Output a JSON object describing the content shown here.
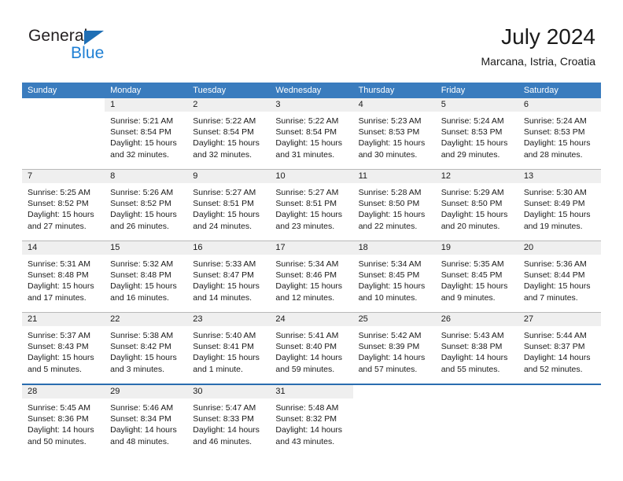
{
  "brand": {
    "word1": "General",
    "word2": "Blue",
    "accent_color": "#1e7fd4"
  },
  "header": {
    "title": "July 2024",
    "subtitle": "Marcana, Istria, Croatia"
  },
  "calendar": {
    "header_color": "#3a7cbe",
    "daynum_band_color": "#efefef",
    "weekday_headers": [
      "Sunday",
      "Monday",
      "Tuesday",
      "Wednesday",
      "Thursday",
      "Friday",
      "Saturday"
    ],
    "weeks": [
      {
        "days": [
          {
            "date": "",
            "empty": true,
            "lines": []
          },
          {
            "date": "1",
            "empty": false,
            "lines": [
              "Sunrise: 5:21 AM",
              "Sunset: 8:54 PM",
              "Daylight: 15 hours",
              "and 32 minutes."
            ]
          },
          {
            "date": "2",
            "empty": false,
            "lines": [
              "Sunrise: 5:22 AM",
              "Sunset: 8:54 PM",
              "Daylight: 15 hours",
              "and 32 minutes."
            ]
          },
          {
            "date": "3",
            "empty": false,
            "lines": [
              "Sunrise: 5:22 AM",
              "Sunset: 8:54 PM",
              "Daylight: 15 hours",
              "and 31 minutes."
            ]
          },
          {
            "date": "4",
            "empty": false,
            "lines": [
              "Sunrise: 5:23 AM",
              "Sunset: 8:53 PM",
              "Daylight: 15 hours",
              "and 30 minutes."
            ]
          },
          {
            "date": "5",
            "empty": false,
            "lines": [
              "Sunrise: 5:24 AM",
              "Sunset: 8:53 PM",
              "Daylight: 15 hours",
              "and 29 minutes."
            ]
          },
          {
            "date": "6",
            "empty": false,
            "lines": [
              "Sunrise: 5:24 AM",
              "Sunset: 8:53 PM",
              "Daylight: 15 hours",
              "and 28 minutes."
            ]
          }
        ]
      },
      {
        "days": [
          {
            "date": "7",
            "empty": false,
            "lines": [
              "Sunrise: 5:25 AM",
              "Sunset: 8:52 PM",
              "Daylight: 15 hours",
              "and 27 minutes."
            ]
          },
          {
            "date": "8",
            "empty": false,
            "lines": [
              "Sunrise: 5:26 AM",
              "Sunset: 8:52 PM",
              "Daylight: 15 hours",
              "and 26 minutes."
            ]
          },
          {
            "date": "9",
            "empty": false,
            "lines": [
              "Sunrise: 5:27 AM",
              "Sunset: 8:51 PM",
              "Daylight: 15 hours",
              "and 24 minutes."
            ]
          },
          {
            "date": "10",
            "empty": false,
            "lines": [
              "Sunrise: 5:27 AM",
              "Sunset: 8:51 PM",
              "Daylight: 15 hours",
              "and 23 minutes."
            ]
          },
          {
            "date": "11",
            "empty": false,
            "lines": [
              "Sunrise: 5:28 AM",
              "Sunset: 8:50 PM",
              "Daylight: 15 hours",
              "and 22 minutes."
            ]
          },
          {
            "date": "12",
            "empty": false,
            "lines": [
              "Sunrise: 5:29 AM",
              "Sunset: 8:50 PM",
              "Daylight: 15 hours",
              "and 20 minutes."
            ]
          },
          {
            "date": "13",
            "empty": false,
            "lines": [
              "Sunrise: 5:30 AM",
              "Sunset: 8:49 PM",
              "Daylight: 15 hours",
              "and 19 minutes."
            ]
          }
        ]
      },
      {
        "days": [
          {
            "date": "14",
            "empty": false,
            "lines": [
              "Sunrise: 5:31 AM",
              "Sunset: 8:48 PM",
              "Daylight: 15 hours",
              "and 17 minutes."
            ]
          },
          {
            "date": "15",
            "empty": false,
            "lines": [
              "Sunrise: 5:32 AM",
              "Sunset: 8:48 PM",
              "Daylight: 15 hours",
              "and 16 minutes."
            ]
          },
          {
            "date": "16",
            "empty": false,
            "lines": [
              "Sunrise: 5:33 AM",
              "Sunset: 8:47 PM",
              "Daylight: 15 hours",
              "and 14 minutes."
            ]
          },
          {
            "date": "17",
            "empty": false,
            "lines": [
              "Sunrise: 5:34 AM",
              "Sunset: 8:46 PM",
              "Daylight: 15 hours",
              "and 12 minutes."
            ]
          },
          {
            "date": "18",
            "empty": false,
            "lines": [
              "Sunrise: 5:34 AM",
              "Sunset: 8:45 PM",
              "Daylight: 15 hours",
              "and 10 minutes."
            ]
          },
          {
            "date": "19",
            "empty": false,
            "lines": [
              "Sunrise: 5:35 AM",
              "Sunset: 8:45 PM",
              "Daylight: 15 hours",
              "and 9 minutes."
            ]
          },
          {
            "date": "20",
            "empty": false,
            "lines": [
              "Sunrise: 5:36 AM",
              "Sunset: 8:44 PM",
              "Daylight: 15 hours",
              "and 7 minutes."
            ]
          }
        ]
      },
      {
        "days": [
          {
            "date": "21",
            "empty": false,
            "lines": [
              "Sunrise: 5:37 AM",
              "Sunset: 8:43 PM",
              "Daylight: 15 hours",
              "and 5 minutes."
            ]
          },
          {
            "date": "22",
            "empty": false,
            "lines": [
              "Sunrise: 5:38 AM",
              "Sunset: 8:42 PM",
              "Daylight: 15 hours",
              "and 3 minutes."
            ]
          },
          {
            "date": "23",
            "empty": false,
            "lines": [
              "Sunrise: 5:40 AM",
              "Sunset: 8:41 PM",
              "Daylight: 15 hours",
              "and 1 minute."
            ]
          },
          {
            "date": "24",
            "empty": false,
            "lines": [
              "Sunrise: 5:41 AM",
              "Sunset: 8:40 PM",
              "Daylight: 14 hours",
              "and 59 minutes."
            ]
          },
          {
            "date": "25",
            "empty": false,
            "lines": [
              "Sunrise: 5:42 AM",
              "Sunset: 8:39 PM",
              "Daylight: 14 hours",
              "and 57 minutes."
            ]
          },
          {
            "date": "26",
            "empty": false,
            "lines": [
              "Sunrise: 5:43 AM",
              "Sunset: 8:38 PM",
              "Daylight: 14 hours",
              "and 55 minutes."
            ]
          },
          {
            "date": "27",
            "empty": false,
            "lines": [
              "Sunrise: 5:44 AM",
              "Sunset: 8:37 PM",
              "Daylight: 14 hours",
              "and 52 minutes."
            ]
          }
        ]
      },
      {
        "days": [
          {
            "date": "28",
            "empty": false,
            "lines": [
              "Sunrise: 5:45 AM",
              "Sunset: 8:36 PM",
              "Daylight: 14 hours",
              "and 50 minutes."
            ]
          },
          {
            "date": "29",
            "empty": false,
            "lines": [
              "Sunrise: 5:46 AM",
              "Sunset: 8:34 PM",
              "Daylight: 14 hours",
              "and 48 minutes."
            ]
          },
          {
            "date": "30",
            "empty": false,
            "lines": [
              "Sunrise: 5:47 AM",
              "Sunset: 8:33 PM",
              "Daylight: 14 hours",
              "and 46 minutes."
            ]
          },
          {
            "date": "31",
            "empty": false,
            "lines": [
              "Sunrise: 5:48 AM",
              "Sunset: 8:32 PM",
              "Daylight: 14 hours",
              "and 43 minutes."
            ]
          },
          {
            "date": "",
            "empty": true,
            "lines": []
          },
          {
            "date": "",
            "empty": true,
            "lines": []
          },
          {
            "date": "",
            "empty": true,
            "lines": []
          }
        ]
      }
    ]
  }
}
